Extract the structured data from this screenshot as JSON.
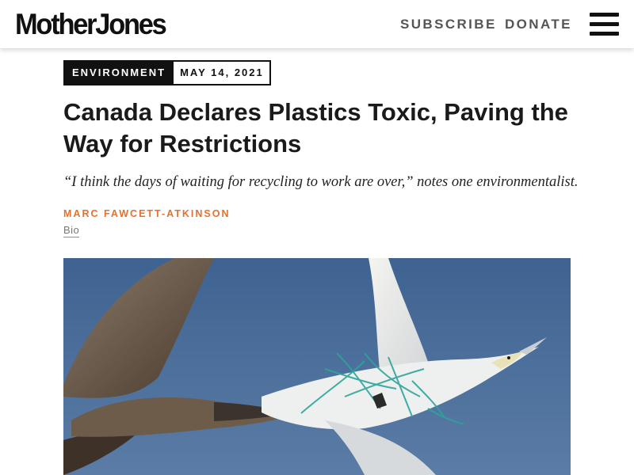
{
  "header": {
    "logo_text": "MotherJones",
    "subscribe_label": "SUBSCRIBE",
    "donate_label": "DONATE",
    "menu_icon": "hamburger-menu-icon"
  },
  "article": {
    "category": "ENVIRONMENT",
    "date": "MAY 14, 2021",
    "headline": "Canada Declares Plastics Toxic, Paving the Way for Restrictions",
    "dek": "“I think the days of waiting for recycling to work are over,” notes one environmentalist.",
    "author": "MARC FAWCETT-ATKINSON",
    "bio_label": "Bio",
    "lead_image": {
      "subject": "two gannets in flight, one entangled in green plastic netting, against a blue sky"
    }
  },
  "colors": {
    "accent": "#e8702a",
    "text": "#111111",
    "nav_text": "#555555",
    "sky": "#4a6f9c"
  }
}
